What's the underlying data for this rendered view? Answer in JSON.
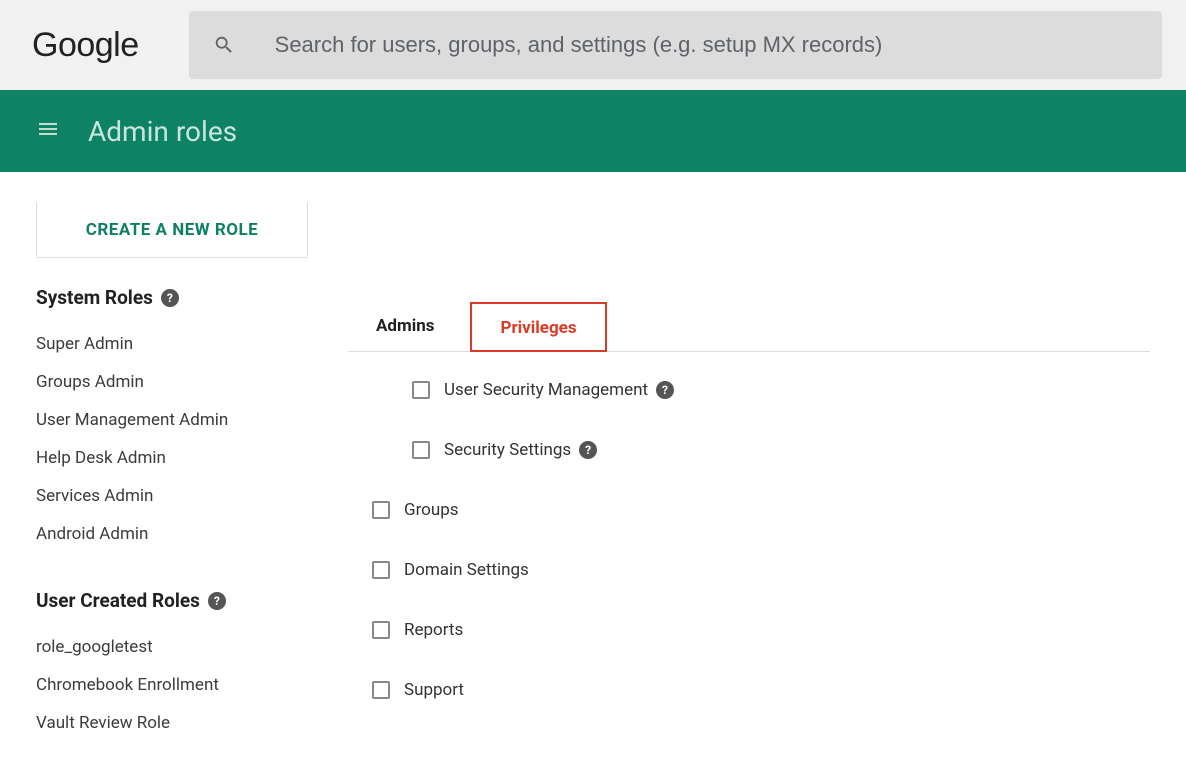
{
  "header": {
    "logo_text": "Google",
    "search_placeholder": "Search for users, groups, and settings (e.g. setup MX records)"
  },
  "green_bar": {
    "title": "Admin roles"
  },
  "sidebar": {
    "create_button": "CREATE A NEW ROLE",
    "system_roles_heading": "System Roles",
    "system_roles": [
      "Super Admin",
      "Groups Admin",
      "User Management Admin",
      "Help Desk Admin",
      "Services Admin",
      "Android Admin"
    ],
    "user_roles_heading": "User Created Roles",
    "user_roles": [
      "role_googletest",
      "Chromebook Enrollment",
      "Vault Review Role"
    ]
  },
  "tabs": {
    "admins": "Admins",
    "privileges": "Privileges"
  },
  "privileges": {
    "user_security": "User Security Management",
    "security_settings": "Security Settings",
    "groups": "Groups",
    "domain_settings": "Domain Settings",
    "reports": "Reports",
    "support": "Support"
  }
}
